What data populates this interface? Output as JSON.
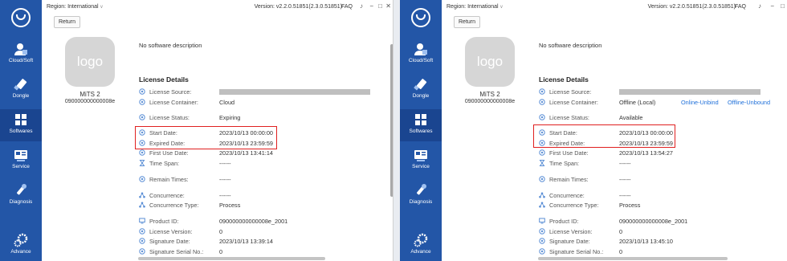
{
  "colors": {
    "sidebar": "#2356a7",
    "sidebar_active": "#1a4590",
    "link": "#1e6fd9",
    "highlight": "#e02020"
  },
  "sidebar_items": [
    {
      "label": "Cloud/Soft",
      "icon": "user-icon"
    },
    {
      "label": "Dongle",
      "icon": "dongle-icon"
    },
    {
      "label": "Softwares",
      "icon": "cube-icon",
      "active": true
    },
    {
      "label": "Service",
      "icon": "service-icon"
    },
    {
      "label": "Diagnosis",
      "icon": "wrench-icon"
    },
    {
      "label": "Advance",
      "icon": "gears-icon"
    }
  ],
  "topbar": {
    "region": "Region: International",
    "version": "Version: v2.2.0.51851(2.3.0.51851)",
    "faq": "FAQ"
  },
  "return_label": "Return",
  "logo_text": "logo",
  "product": {
    "name": "MiTS 2",
    "id": "090000000000008e"
  },
  "description": "No software description",
  "details_title": "License Details",
  "labels": {
    "source": "License Source:",
    "container": "License Container:",
    "status": "License Status:",
    "start": "Start Date:",
    "expired": "Expired Date:",
    "first_use": "First Use Date:",
    "time_span": "Time Span:",
    "remain": "Remain Times:",
    "concurrence": "Concurrence:",
    "concurrence_type": "Concurrence Type:",
    "product_id": "Product ID:",
    "license_version": "License Version:",
    "signature_date": "Signature Date:",
    "signature_serial": "Signature Serial No.:"
  },
  "left": {
    "container": "Cloud",
    "status": "Expiring",
    "start": "2023/10/13 00:00:00",
    "expired": "2023/10/13 23:59:59",
    "first_use": "2023/10/13 13:41:14",
    "time_span": "------",
    "remain": "------",
    "concurrence": "------",
    "concurrence_type": "Process",
    "product_id": "090000000000008e_2001",
    "license_version": "0",
    "signature_date": "2023/10/13 13:39:14",
    "signature_serial": "0"
  },
  "right": {
    "container": "Offline (Local)",
    "online_unbind": "Online-Unbind",
    "offline_unbound": "Offline-Unbound",
    "status": "Available",
    "start": "2023/10/13 00:00:00",
    "expired": "2023/10/13 23:59:59",
    "first_use": "2023/10/13 13:54:27",
    "time_span": "------",
    "remain": "------",
    "concurrence": "------",
    "concurrence_type": "Process",
    "product_id": "090000000000008e_2001",
    "license_version": "0",
    "signature_date": "2023/10/13 13:45:10",
    "signature_serial": "0"
  }
}
